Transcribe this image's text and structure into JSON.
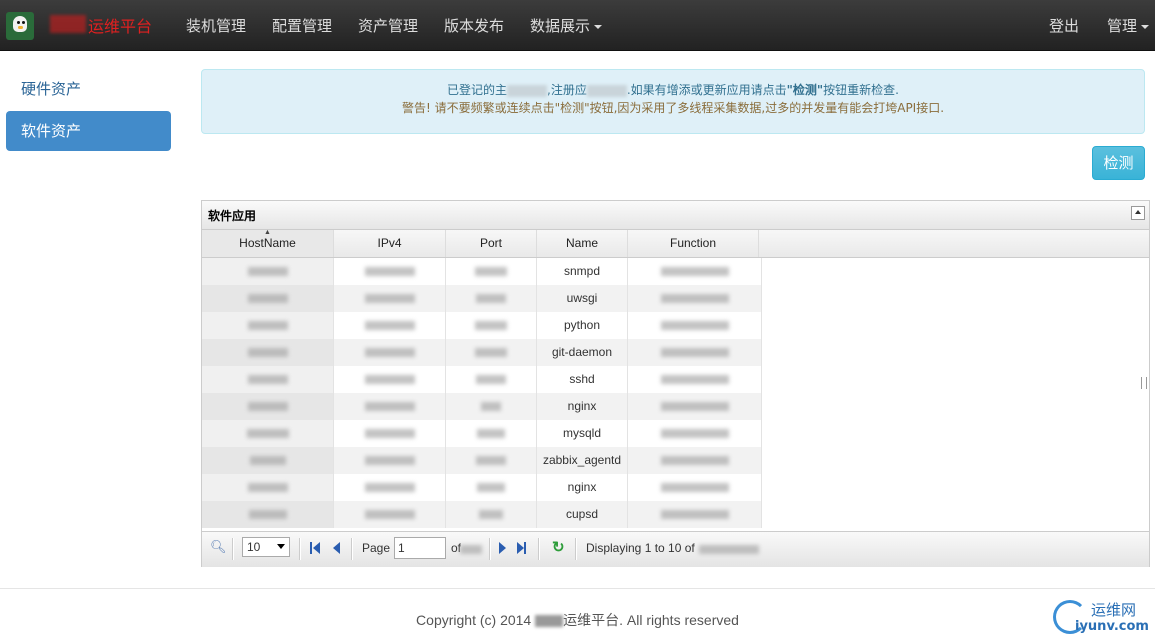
{
  "brand": {
    "suffix": "运维平台"
  },
  "nav": {
    "items": [
      "装机管理",
      "配置管理",
      "资产管理",
      "版本发布",
      "数据展示"
    ],
    "logout": "登出",
    "admin": "管理"
  },
  "sidebar": {
    "items": [
      "硬件资产",
      "软件资产"
    ]
  },
  "alert": {
    "line1_prefix": "已登记的主",
    "line1_mid": ",注册应",
    "line1_rest": ".如果有增添或更新应用请点击",
    "line1_emph": "\"检测\"",
    "line1_end": "按钮重新检查.",
    "line2": "警告! 请不要频繁或连续点击\"检测\"按钮,因为采用了多线程采集数据,过多的并发量有能会打垮API接口."
  },
  "check_button": "检测",
  "grid": {
    "title": "软件应用",
    "columns": [
      "HostName",
      "IPv4",
      "Port",
      "Name",
      "Function"
    ],
    "rows": [
      {
        "name": "snmpd"
      },
      {
        "name": "uwsgi"
      },
      {
        "name": "python"
      },
      {
        "name": "git-daemon"
      },
      {
        "name": "sshd"
      },
      {
        "name": "nginx"
      },
      {
        "name": "mysqld"
      },
      {
        "name": "zabbix_agentd"
      },
      {
        "name": "nginx"
      },
      {
        "name": "cupsd"
      }
    ]
  },
  "pager": {
    "page_size": "10",
    "page_label": "Page",
    "page_value": "1",
    "of_label": "of",
    "display_text": "Displaying 1 to 10 of"
  },
  "footer": {
    "prefix": "Copyright (c) 2014",
    "suffix": "运维平台. All rights reserved"
  },
  "watermark": {
    "cn": "运维网",
    "url": "iyunv.com"
  },
  "colors": {
    "navbar": "#222222",
    "active_sidebar": "#428bca",
    "check_button": "#5bc0de",
    "brand": "#e02020"
  }
}
